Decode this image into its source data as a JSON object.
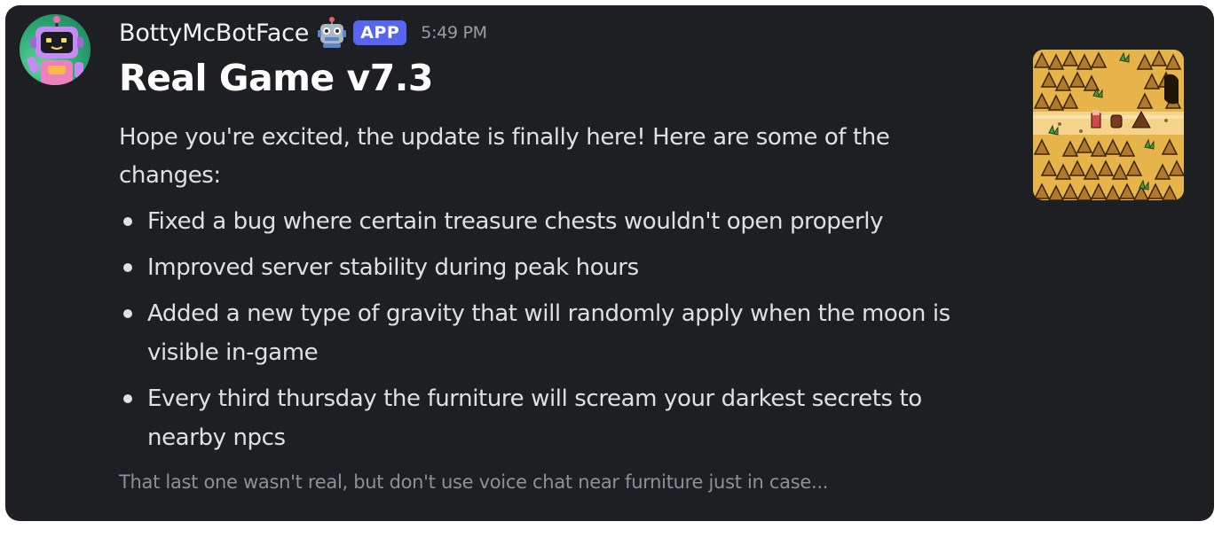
{
  "message": {
    "username": "BottyMcBotFace",
    "badge": "APP",
    "timestamp": "5:49 PM",
    "avatar_icon": "robot-avatar-icon",
    "emoji_icon": "robot-face-icon"
  },
  "embed": {
    "title": "Real Game v7.3",
    "intro": "Hope you're excited, the update is finally here! Here are some of the changes:",
    "bullets": [
      "Fixed a bug where certain treasure chests wouldn't open properly",
      "Improved server stability during peak hours",
      "Added a new type of gravity that will randomly apply when the moon is visible in-game",
      "Every third thursday the furniture will scream your darkest secrets to nearby npcs"
    ],
    "footer": "That last one wasn't real, but don't use voice chat near furniture just in case...",
    "thumbnail": "pixel-art-game-screenshot"
  },
  "colors": {
    "background": "#1e1f23",
    "badge": "#5865f2",
    "text": "#dfe0e4",
    "muted": "#8e9097"
  }
}
